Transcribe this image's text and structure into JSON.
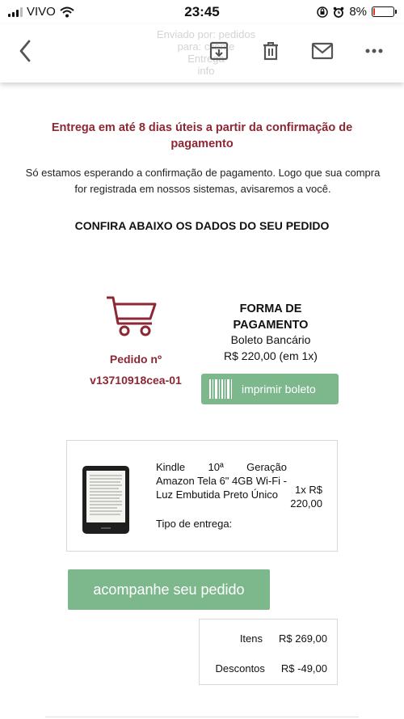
{
  "status_bar": {
    "carrier": "VIVO",
    "time": "23:45",
    "battery_percent": "8%",
    "battery_level": 0.08,
    "battery_color": "#e0341f"
  },
  "toolbar": {
    "back_icon": "chevron-left-icon",
    "archive_icon": "archive-download-icon",
    "delete_icon": "trash-icon",
    "mail_icon": "envelope-icon",
    "more_icon": "more-dots-icon"
  },
  "email": {
    "headline": "Entrega em até 8 dias úteis a partir da confirmação de pagamento",
    "intro": "Só estamos esperando a confirmação de pagamento. Logo que sua compra for registrada em nossos sistemas, avisaremos a você.",
    "section_title": "CONFIRA ABAIXO OS DADOS DO SEU PEDIDO",
    "order": {
      "label": "Pedido nº",
      "number": "v13710918cea-01"
    },
    "payment": {
      "title": "FORMA DE PAGAMENTO",
      "method": "Boleto Bancário",
      "amount": "R$ 220,00 (em 1x)",
      "print_button": "imprimir boleto"
    },
    "product": {
      "name": "Kindle 10ª Geração Amazon Tela 6\" 4GB Wi-Fi - Luz Embutida Preto Único",
      "delivery_label": "Tipo de entrega:",
      "quantity_price": "1x R$ 220,00"
    },
    "track_button": "acompanhe seu pedido",
    "totals": {
      "items_label": "Itens",
      "items_value": "R$ 269,00",
      "discounts_label": "Descontos",
      "discounts_value": "R$ -49,00"
    },
    "colors": {
      "accent_red": "#8c2734",
      "button_green": "#7db88c"
    }
  }
}
